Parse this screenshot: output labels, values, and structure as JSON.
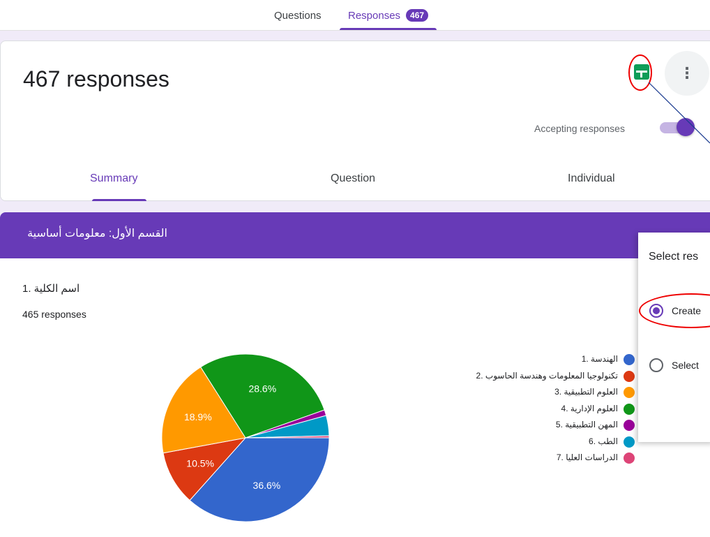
{
  "nav": {
    "tabs": [
      {
        "label": "Questions"
      },
      {
        "label": "Responses",
        "badge": "467"
      }
    ]
  },
  "header": {
    "title": "467 responses",
    "accepting_label": "Accepting responses",
    "accepting_on": true,
    "sheets_icon": "google-sheets-icon",
    "more_icon": "more-vert-icon",
    "sub_tabs": [
      {
        "label": "Summary",
        "active": true
      },
      {
        "label": "Question"
      },
      {
        "label": "Individual"
      }
    ]
  },
  "section": {
    "title": "القسم الأول: معلومات أساسية"
  },
  "question": {
    "title": "اسم الكلية .1",
    "response_count": "465 responses",
    "chart_data": {
      "type": "pie",
      "categories": [
        "الهندسة .1",
        "تكنولوجيا المعلومات وهندسة الحاسوب .2",
        "العلوم التطبيقية .3",
        "العلوم الإدارية .4",
        "المهن التطبيقية .5",
        "الطب .6",
        "الدراسات العليا .7"
      ],
      "values": [
        36.6,
        10.5,
        18.9,
        28.6,
        1.1,
        3.9,
        0.4
      ],
      "slice_labels": [
        "36.6%",
        "10.5%",
        "18.9%",
        "28.6%",
        "",
        "",
        ""
      ],
      "colors": [
        "#3366cc",
        "#dc3912",
        "#ff9900",
        "#109618",
        "#990099",
        "#0099c6",
        "#dd4477"
      ],
      "legend_position": "right"
    }
  },
  "dialog": {
    "title": "Select res",
    "options": [
      {
        "label": "Create",
        "checked": true
      },
      {
        "label": "Select"
      }
    ]
  },
  "colors": {
    "accent": "#673ab7",
    "background": "#f0ebf8",
    "sheets_green": "#0f9d58",
    "annotation_red": "#e00000"
  }
}
